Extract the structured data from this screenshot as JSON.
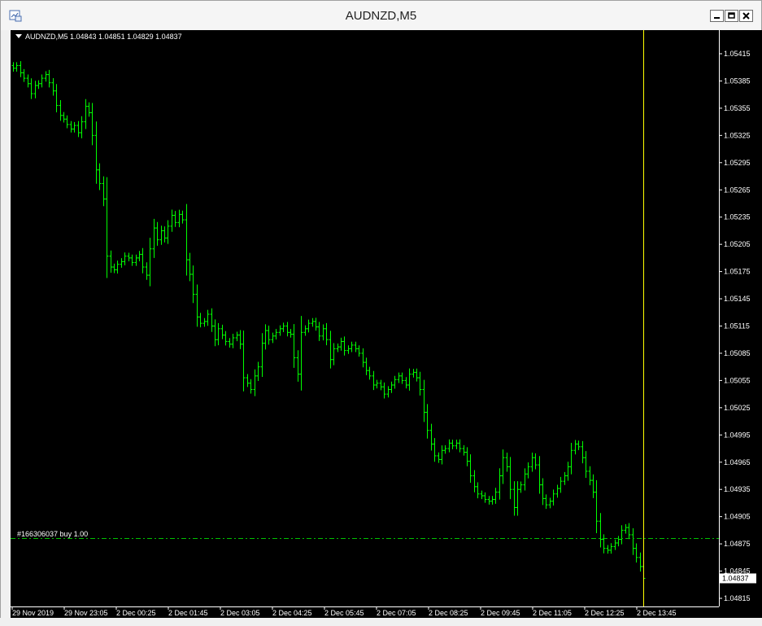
{
  "window": {
    "title": "AUDNZD,M5",
    "icon": "chart-window-icon",
    "controls": [
      "minimize-icon",
      "restore-icon",
      "close-icon"
    ]
  },
  "chart": {
    "symbol_info": "AUDNZD,M5  1.04843 1.04851 1.04829 1.04837",
    "order_label": "#166306037 buy 1.00",
    "current_price_label": "1.04837",
    "price_ticks": [
      "1.05415",
      "1.05385",
      "1.05355",
      "1.05325",
      "1.05295",
      "1.05265",
      "1.05235",
      "1.05205",
      "1.05175",
      "1.05145",
      "1.05115",
      "1.05085",
      "1.05055",
      "1.05025",
      "1.04995",
      "1.04965",
      "1.04935",
      "1.04905",
      "1.04875",
      "1.04845",
      "1.04815"
    ],
    "time_ticks": [
      "29 Nov 2019",
      "29 Nov 23:05",
      "2 Dec 00:25",
      "2 Dec 01:45",
      "2 Dec 03:05",
      "2 Dec 04:25",
      "2 Dec 05:45",
      "2 Dec 07:05",
      "2 Dec 08:25",
      "2 Dec 09:45",
      "2 Dec 11:05",
      "2 Dec 12:25",
      "2 Dec 13:45"
    ],
    "colors": {
      "background": "#000000",
      "bars": "#00ff00",
      "text": "#ffffff",
      "grid_axis": "#ffffff",
      "vline": "#ffff00",
      "order_line": "#00c000"
    }
  },
  "chart_data": {
    "type": "ohlc",
    "symbol": "AUDNZD",
    "timeframe": "M5",
    "ylim": [
      1.04815,
      1.05435
    ],
    "bars": [
      1.05399,
      1.05402,
      1.05394,
      1.05388,
      1.05382,
      1.05371,
      1.0538,
      1.05382,
      1.05388,
      1.05392,
      1.05383,
      1.05374,
      1.05358,
      1.05347,
      1.05343,
      1.05337,
      1.05332,
      1.05336,
      1.05328,
      1.0534,
      1.05357,
      1.0535,
      1.05325,
      1.05287,
      1.05272,
      1.05255,
      1.05192,
      1.0518,
      1.05177,
      1.05183,
      1.05186,
      1.05192,
      1.0519,
      1.05185,
      1.0519,
      1.05194,
      1.0518,
      1.05171,
      1.052,
      1.05223,
      1.0521,
      1.0522,
      1.05212,
      1.05225,
      1.05237,
      1.05229,
      1.05238,
      1.05232,
      1.05188,
      1.05172,
      1.0515,
      1.05125,
      1.05118,
      1.0512,
      1.05128,
      1.05115,
      1.051,
      1.05112,
      1.05105,
      1.05098,
      1.05095,
      1.05102,
      1.05105,
      1.05095,
      1.05058,
      1.05052,
      1.05045,
      1.0506,
      1.0507,
      1.05096,
      1.0511,
      1.051,
      1.05104,
      1.05108,
      1.05112,
      1.05115,
      1.05108,
      1.05106,
      1.0508,
      1.05062,
      1.05108,
      1.05112,
      1.05118,
      1.0512,
      1.05114,
      1.05104,
      1.05112,
      1.051,
      1.05078,
      1.0509,
      1.05092,
      1.05098,
      1.05088,
      1.0509,
      1.05094,
      1.0509,
      1.05085,
      1.05075,
      1.05066,
      1.0506,
      1.0505,
      1.05052,
      1.05048,
      1.0504,
      1.05045,
      1.0505,
      1.05056,
      1.0506,
      1.05055,
      1.0505,
      1.05062,
      1.05064,
      1.05058,
      1.05045,
      1.0502,
      1.05,
      1.04985,
      1.04972,
      1.04968,
      1.04978,
      1.0498,
      1.04986,
      1.04983,
      1.04986,
      1.0498,
      1.04976,
      1.04966,
      1.0495,
      1.04938,
      1.0493,
      1.04928,
      1.04924,
      1.04922,
      1.04924,
      1.04932,
      1.0495,
      1.0497,
      1.0496,
      1.04935,
      1.04915,
      1.04935,
      1.0494,
      1.04952,
      1.0496,
      1.0497,
      1.04962,
      1.0494,
      1.04925,
      1.04918,
      1.04922,
      1.0493,
      1.04936,
      1.04944,
      1.0495,
      1.0496,
      1.04978,
      1.04985,
      1.04982,
      1.0497,
      1.04955,
      1.04945,
      1.04932,
      1.049,
      1.0488,
      1.0487,
      1.04868,
      1.04872,
      1.04876,
      1.0488,
      1.0489,
      1.04893,
      1.04885,
      1.0487,
      1.0486,
      1.0485,
      1.04837
    ]
  }
}
